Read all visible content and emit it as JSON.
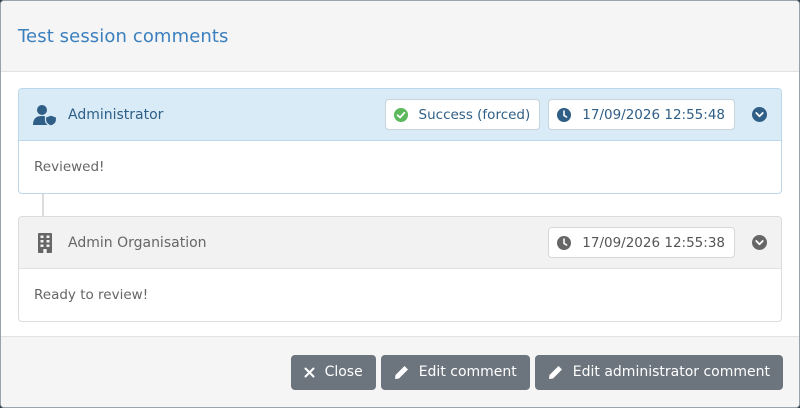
{
  "modal": {
    "title": "Test session comments"
  },
  "comments": [
    {
      "author": "Administrator",
      "author_icon": "user-shield-icon",
      "status": "Success (forced)",
      "status_icon": "check-circle-icon",
      "timestamp": "17/09/2026 12:55:48",
      "text": "Reviewed!"
    },
    {
      "author": "Admin Organisation",
      "author_icon": "building-icon",
      "timestamp": "17/09/2026 12:55:38",
      "text": "Ready to review!"
    }
  ],
  "footer": {
    "close_label": "Close",
    "edit_comment_label": "Edit comment",
    "edit_admin_comment_label": "Edit administrator comment"
  },
  "colors": {
    "accent": "#3a7fbe",
    "success": "#5cb85c",
    "button": "#6c757d"
  }
}
